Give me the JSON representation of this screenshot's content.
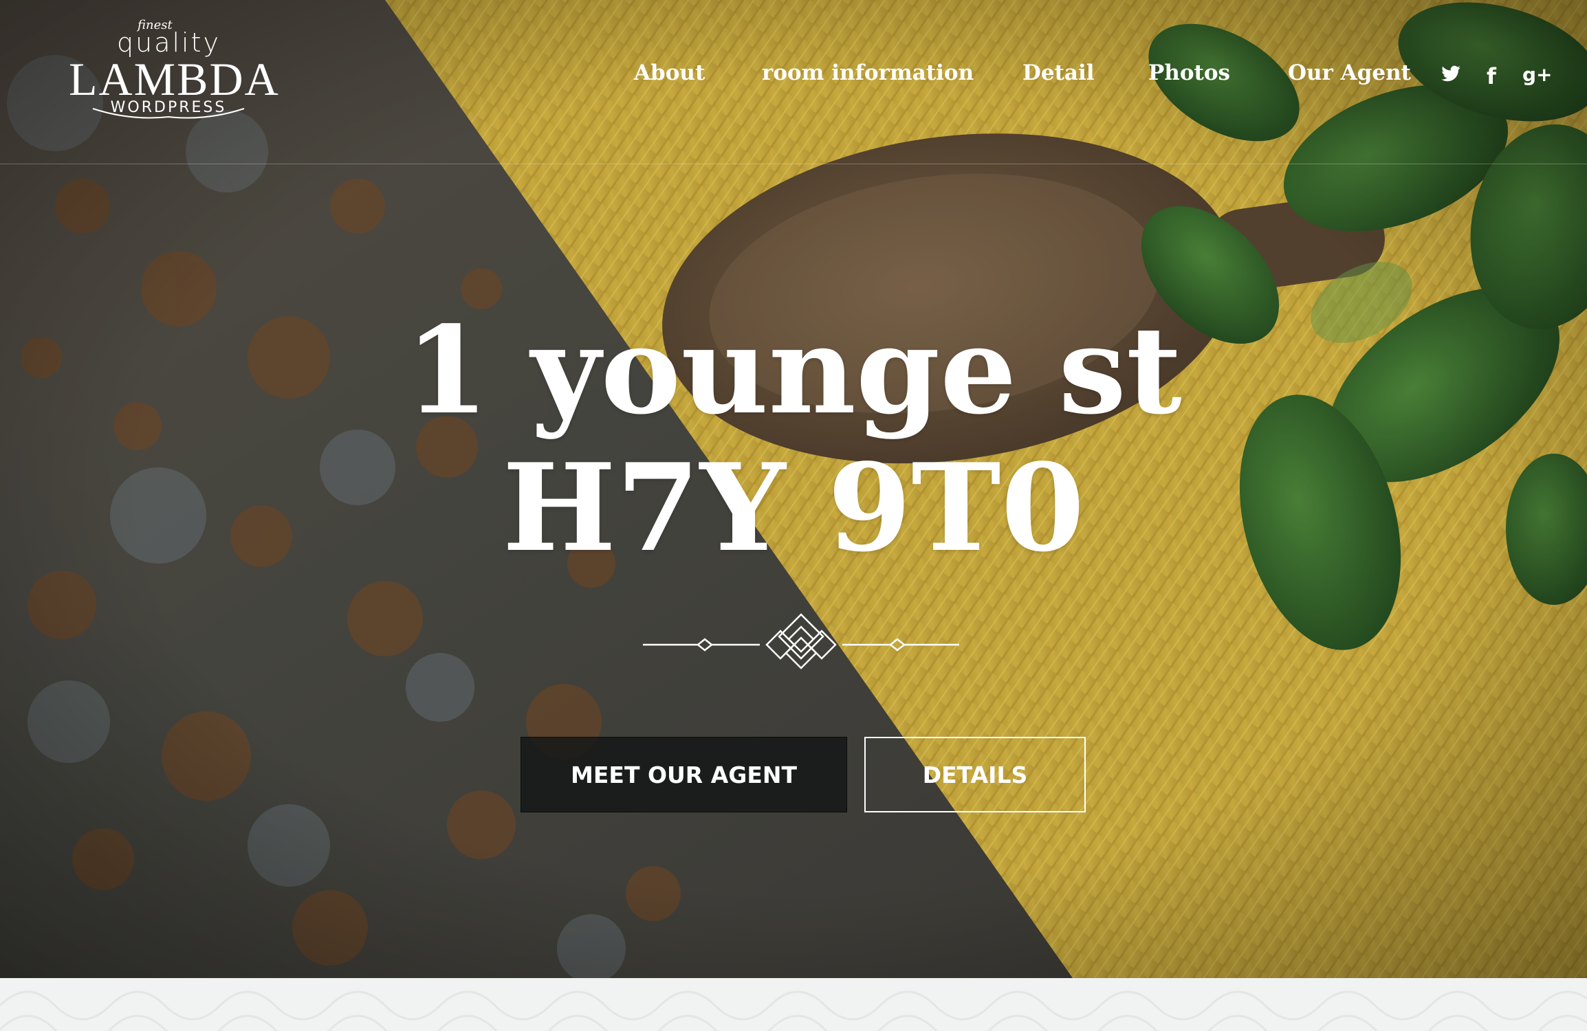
{
  "logo": {
    "finest": "finest",
    "quality": "quality",
    "name": "LAMBDA",
    "sub": "WORDPRESS"
  },
  "nav": {
    "items": [
      {
        "label": "About"
      },
      {
        "label": "room information"
      },
      {
        "label": "Detail"
      },
      {
        "label": "Photos"
      },
      {
        "label": "Our Agent"
      }
    ]
  },
  "social": {
    "icons": [
      "twitter-icon",
      "facebook-icon",
      "google-plus-icon"
    ],
    "facebook_glyph": "f",
    "google_glyph": "g+"
  },
  "hero": {
    "line1": "1 younge st",
    "line2": "H7Y 9T0"
  },
  "buttons": {
    "agent": "MEET OUR AGENT",
    "details": "DETAILS"
  },
  "colors": {
    "accent_text": "#ffffff",
    "button_dark": "#121616",
    "strip_bg": "#f1f2f2"
  }
}
